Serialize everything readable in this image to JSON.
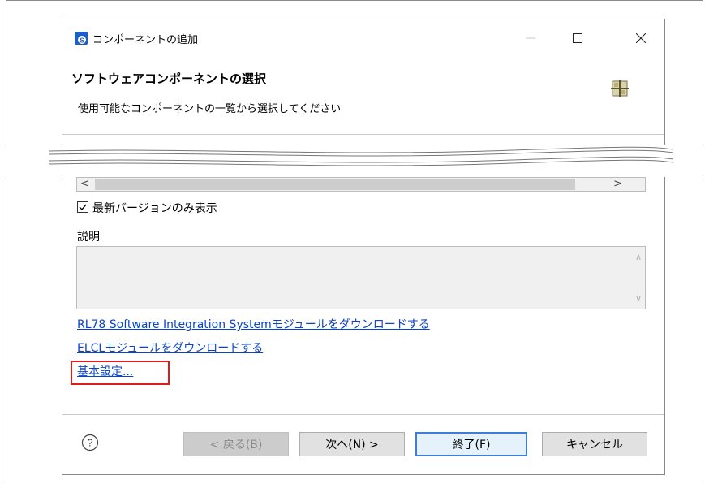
{
  "window": {
    "title": "コンポーネントの追加",
    "minimize": "—",
    "maximize": "☐",
    "close": "✕"
  },
  "header": {
    "title": "ソフトウェアコンポーネントの選択",
    "subtitle": "使用可能なコンポーネントの一覧から選択してください"
  },
  "scrollbar": {
    "left_arrow": "<",
    "right_arrow": ">"
  },
  "options": {
    "latest_only_checked": true,
    "latest_only_label": "最新バージョンのみ表示"
  },
  "description": {
    "label": "説明",
    "up_arrow": "∧",
    "down_arrow": "∨"
  },
  "links": {
    "download_sis": "RL78 Software Integration Systemモジュールをダウンロードする",
    "download_elcl": "ELCLモジュールをダウンロードする",
    "basic_settings": "基本設定..."
  },
  "buttons": {
    "back": "< 戻る(B)",
    "next": "次へ(N) >",
    "finish": "終了(F)",
    "cancel": "キャンセル"
  },
  "colors": {
    "link": "#0b44c8",
    "highlight": "#e01b1b",
    "default_button_border": "#3c7fd6"
  }
}
